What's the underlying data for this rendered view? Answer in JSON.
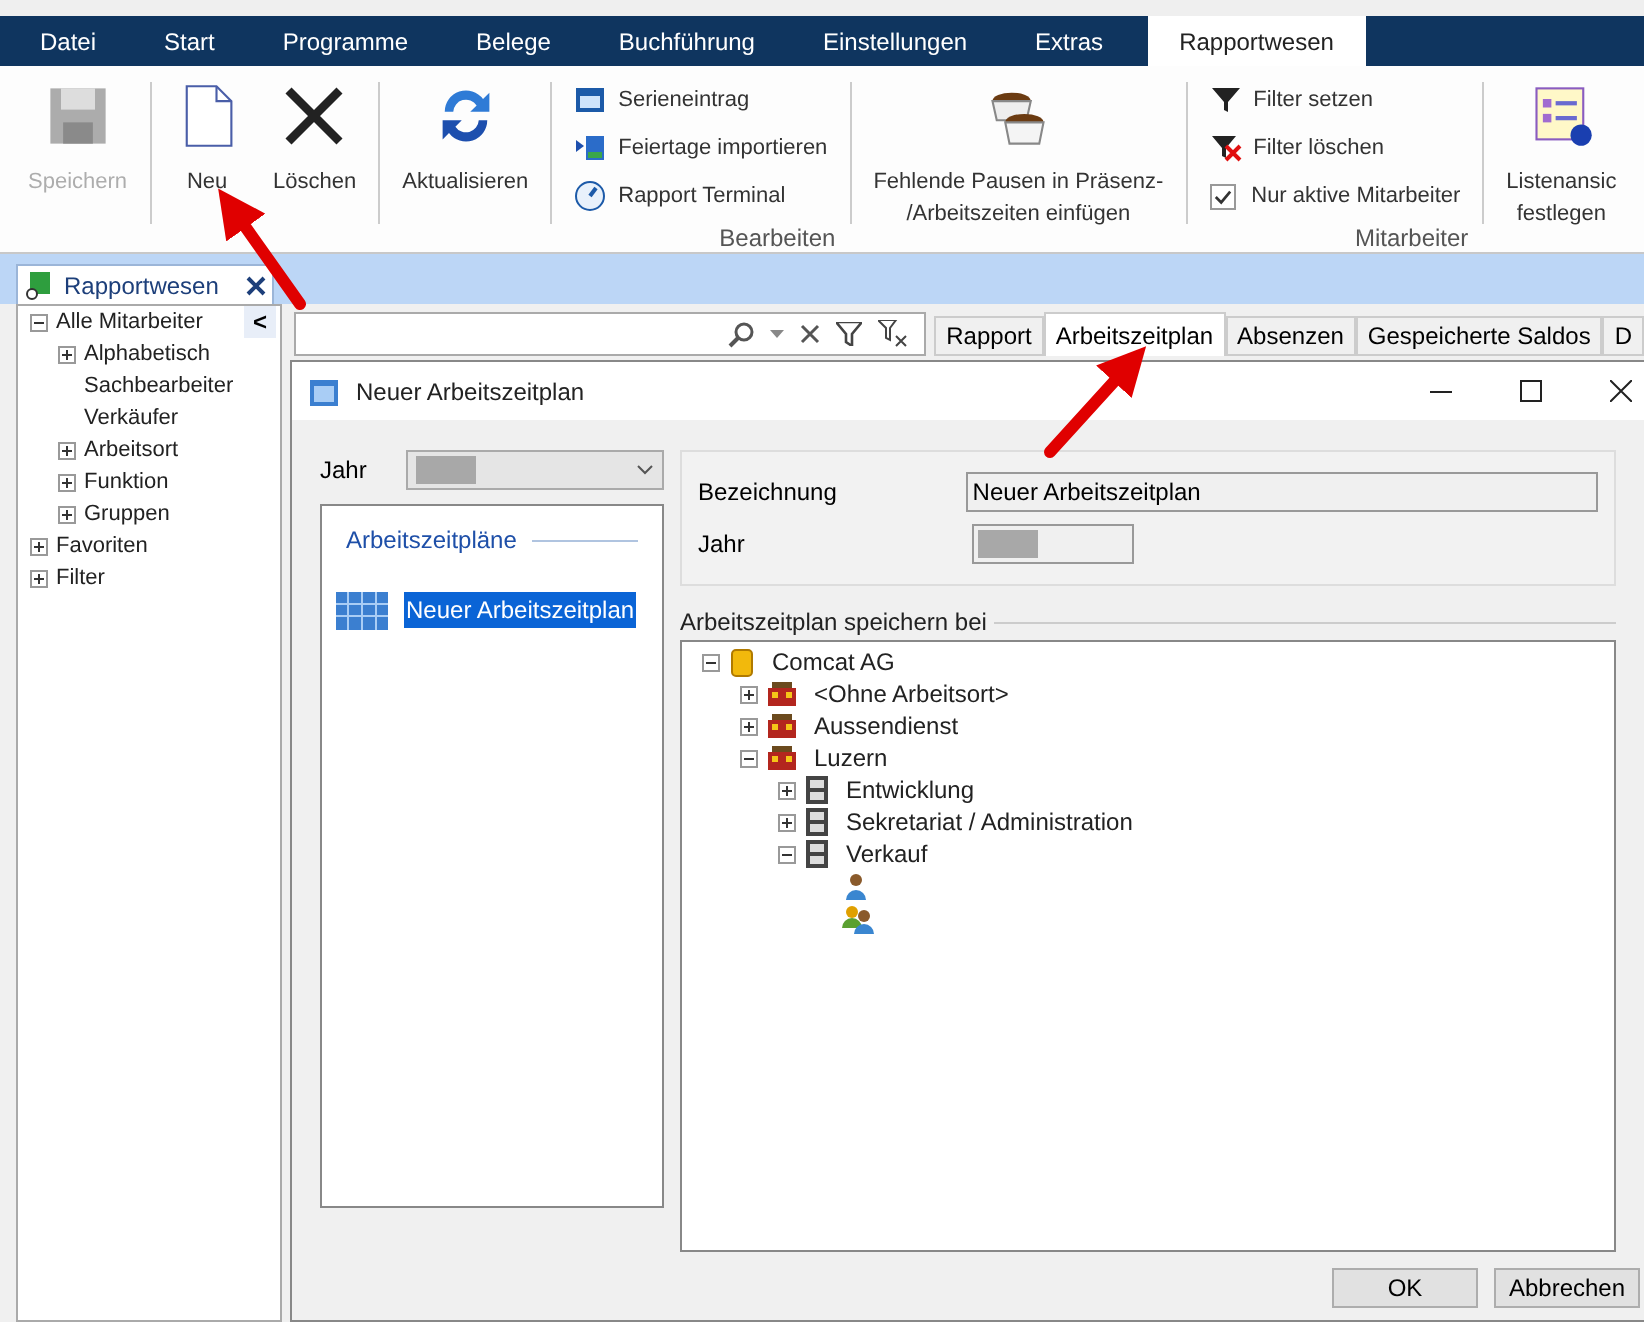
{
  "menu": [
    {
      "label": "Datei",
      "selected": false
    },
    {
      "label": "Start",
      "selected": false
    },
    {
      "label": "Programme",
      "selected": false
    },
    {
      "label": "Belege",
      "selected": false
    },
    {
      "label": "Buchführung",
      "selected": false
    },
    {
      "label": "Einstellungen",
      "selected": false
    },
    {
      "label": "Extras",
      "selected": false
    },
    {
      "label": "Rapportwesen",
      "selected": true
    }
  ],
  "ribbon": [
    {
      "items": [
        {
          "kind": "large",
          "label": "Speichern",
          "disabled": true
        }
      ]
    },
    {
      "items": [
        {
          "kind": "large",
          "label": "Neu",
          "disabled": false
        },
        {
          "kind": "large",
          "label": "Löschen",
          "disabled": false
        }
      ]
    },
    {
      "items": [
        {
          "kind": "large",
          "label": "Aktualisieren",
          "disabled": false
        }
      ]
    },
    {
      "group": "Bearbeiten",
      "items": [
        {
          "kind": "small",
          "label": "Serieneintrag"
        },
        {
          "kind": "small",
          "label": "Feiertage importieren"
        },
        {
          "kind": "small",
          "label": "Rapport Terminal"
        }
      ]
    },
    {
      "items": [
        {
          "kind": "large",
          "label": "Fehlende Pausen in Präsenz-\n/Arbeitszeiten einfügen",
          "disabled": false
        }
      ]
    },
    {
      "group": "Mitarbeiter",
      "items": [
        {
          "kind": "small",
          "label": "Filter setzen"
        },
        {
          "kind": "small",
          "label": "Filter löschen"
        },
        {
          "kind": "checkbox",
          "label": "Nur aktive Mitarbeiter",
          "checked": true
        }
      ]
    },
    {
      "items": [
        {
          "kind": "large",
          "label": "Listenansic\nfestlegen",
          "disabled": false
        }
      ]
    }
  ],
  "document_tab": {
    "title": "Rapportwesen"
  },
  "sidebar": {
    "collapse": "<",
    "tree": [
      {
        "label": "Alle Mitarbeiter",
        "expanded": true,
        "children": [
          {
            "label": "Alphabetisch",
            "expanded": false
          },
          {
            "label": "Sachbearbeiter"
          },
          {
            "label": "Verkäufer"
          },
          {
            "label": "Arbeitsort",
            "expanded": false
          },
          {
            "label": "Funktion",
            "expanded": false
          },
          {
            "label": "Gruppen",
            "expanded": false
          }
        ]
      },
      {
        "label": "Favoriten",
        "expanded": false
      },
      {
        "label": "Filter",
        "expanded": false
      }
    ]
  },
  "tabs": [
    {
      "label": "Rapport",
      "selected": false
    },
    {
      "label": "Arbeitszeitplan",
      "selected": true
    },
    {
      "label": "Absenzen",
      "selected": false
    },
    {
      "label": "Gespeicherte Saldos",
      "selected": false
    },
    {
      "label": "D",
      "selected": false
    }
  ],
  "dialog": {
    "title": "Neuer Arbeitszeitplan",
    "year_label": "Jahr",
    "plans_title": "Arbeitszeitpläne",
    "plans": [
      {
        "label": "Neuer Arbeitszeitplan",
        "selected": true
      }
    ],
    "name_label": "Bezeichnung",
    "name_value": "Neuer Arbeitszeitplan",
    "year_field_label": "Jahr",
    "save_title": "Arbeitszeitplan speichern bei",
    "tree": [
      {
        "kind": "company",
        "label": "Comcat AG",
        "expanded": true,
        "children": [
          {
            "kind": "location",
            "label": "<Ohne Arbeitsort>",
            "expanded": false
          },
          {
            "kind": "location",
            "label": "Aussendienst",
            "expanded": false
          },
          {
            "kind": "location",
            "label": "Luzern",
            "expanded": true,
            "children": [
              {
                "kind": "department",
                "label": "Entwicklung",
                "expanded": false
              },
              {
                "kind": "department",
                "label": "Sekretariat / Administration",
                "expanded": false
              },
              {
                "kind": "department",
                "label": "Verkauf",
                "expanded": true,
                "children": [
                  {
                    "kind": "person"
                  },
                  {
                    "kind": "group"
                  }
                ]
              }
            ]
          }
        ]
      }
    ],
    "buttons": [
      "OK",
      "Abbrechen"
    ]
  }
}
